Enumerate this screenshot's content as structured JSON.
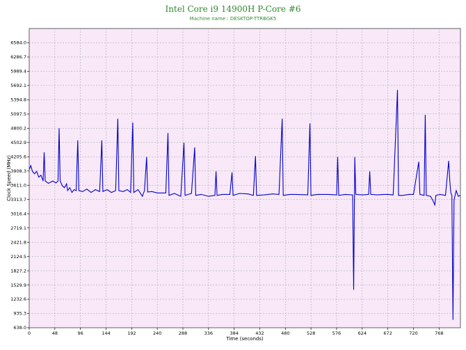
{
  "chart_data": {
    "type": "line",
    "title": "Intel Core i9 14900H P-Core #6",
    "subtitle": "Machine name : DESKTOP-TTRBGK5",
    "xlabel": "Time (seconds)",
    "ylabel": "Clock Speed (MHz)",
    "xlim": [
      0,
      808
    ],
    "ylim": [
      638.0,
      6881.0
    ],
    "x_ticks": [
      0,
      48,
      96,
      144,
      192,
      240,
      288,
      336,
      384,
      432,
      480,
      528,
      576,
      624,
      672,
      720,
      768
    ],
    "y_ticks": [
      "638.0",
      "935.3",
      "1232.6",
      "1529.9",
      "1827.2",
      "2124.5",
      "2421.8",
      "2719.1",
      "3016.4",
      "3313.7",
      "3611.0",
      "3908.3",
      "4205.6",
      "4502.9",
      "4800.2",
      "5097.5",
      "5394.8",
      "5692.1",
      "5989.4",
      "6286.7",
      "6584.0"
    ],
    "grid": true,
    "colors": {
      "plot_bg": "#f8e8f8",
      "line": "#0000cc",
      "grid": "#a0a0a0",
      "title": "#2e8b2e"
    },
    "series": [
      {
        "points": [
          [
            0,
            3940
          ],
          [
            3,
            4020
          ],
          [
            6,
            3900
          ],
          [
            10,
            3850
          ],
          [
            14,
            3900
          ],
          [
            18,
            3780
          ],
          [
            22,
            3820
          ],
          [
            26,
            3700
          ],
          [
            28,
            4300
          ],
          [
            30,
            3700
          ],
          [
            36,
            3650
          ],
          [
            44,
            3700
          ],
          [
            50,
            3660
          ],
          [
            54,
            3700
          ],
          [
            56,
            4800
          ],
          [
            58,
            3700
          ],
          [
            62,
            3600
          ],
          [
            66,
            3560
          ],
          [
            70,
            3640
          ],
          [
            72,
            3500
          ],
          [
            76,
            3560
          ],
          [
            80,
            3460
          ],
          [
            84,
            3520
          ],
          [
            88,
            3500
          ],
          [
            91,
            4550
          ],
          [
            93,
            3500
          ],
          [
            100,
            3480
          ],
          [
            108,
            3530
          ],
          [
            116,
            3460
          ],
          [
            124,
            3520
          ],
          [
            132,
            3480
          ],
          [
            136,
            4550
          ],
          [
            138,
            3480
          ],
          [
            146,
            3520
          ],
          [
            154,
            3460
          ],
          [
            162,
            3500
          ],
          [
            166,
            5000
          ],
          [
            168,
            3500
          ],
          [
            176,
            3480
          ],
          [
            184,
            3520
          ],
          [
            190,
            3460
          ],
          [
            194,
            4920
          ],
          [
            196,
            3460
          ],
          [
            204,
            3520
          ],
          [
            212,
            3380
          ],
          [
            216,
            3500
          ],
          [
            220,
            4200
          ],
          [
            222,
            3470
          ],
          [
            230,
            3480
          ],
          [
            240,
            3450
          ],
          [
            256,
            3450
          ],
          [
            260,
            4700
          ],
          [
            262,
            3400
          ],
          [
            272,
            3440
          ],
          [
            284,
            3380
          ],
          [
            290,
            4500
          ],
          [
            292,
            3400
          ],
          [
            304,
            3440
          ],
          [
            310,
            4400
          ],
          [
            312,
            3400
          ],
          [
            322,
            3420
          ],
          [
            336,
            3380
          ],
          [
            348,
            3400
          ],
          [
            350,
            3900
          ],
          [
            352,
            3400
          ],
          [
            362,
            3420
          ],
          [
            376,
            3420
          ],
          [
            380,
            3880
          ],
          [
            382,
            3400
          ],
          [
            394,
            3440
          ],
          [
            410,
            3430
          ],
          [
            420,
            3400
          ],
          [
            424,
            4220
          ],
          [
            426,
            3400
          ],
          [
            440,
            3410
          ],
          [
            456,
            3430
          ],
          [
            468,
            3420
          ],
          [
            474,
            5000
          ],
          [
            476,
            3400
          ],
          [
            488,
            3420
          ],
          [
            500,
            3420
          ],
          [
            522,
            3410
          ],
          [
            526,
            4900
          ],
          [
            528,
            3400
          ],
          [
            540,
            3420
          ],
          [
            560,
            3420
          ],
          [
            576,
            3410
          ],
          [
            578,
            4200
          ],
          [
            580,
            3400
          ],
          [
            592,
            3420
          ],
          [
            606,
            3410
          ],
          [
            608,
            1430
          ],
          [
            610,
            4200
          ],
          [
            612,
            3420
          ],
          [
            624,
            3410
          ],
          [
            636,
            3420
          ],
          [
            638,
            3900
          ],
          [
            640,
            3420
          ],
          [
            652,
            3410
          ],
          [
            664,
            3420
          ],
          [
            672,
            3420
          ],
          [
            682,
            3410
          ],
          [
            690,
            5600
          ],
          [
            692,
            3400
          ],
          [
            700,
            3400
          ],
          [
            712,
            3420
          ],
          [
            720,
            3420
          ],
          [
            730,
            4100
          ],
          [
            732,
            3420
          ],
          [
            740,
            3400
          ],
          [
            742,
            5080
          ],
          [
            744,
            3400
          ],
          [
            752,
            3380
          ],
          [
            756,
            3300
          ],
          [
            760,
            3200
          ],
          [
            762,
            3400
          ],
          [
            770,
            3420
          ],
          [
            780,
            3400
          ],
          [
            786,
            4120
          ],
          [
            788,
            3700
          ],
          [
            790,
            3450
          ],
          [
            792,
            3400
          ],
          [
            794,
            800
          ],
          [
            796,
            3300
          ],
          [
            798,
            3400
          ],
          [
            800,
            3500
          ],
          [
            804,
            3380
          ],
          [
            808,
            3400
          ]
        ]
      }
    ]
  }
}
